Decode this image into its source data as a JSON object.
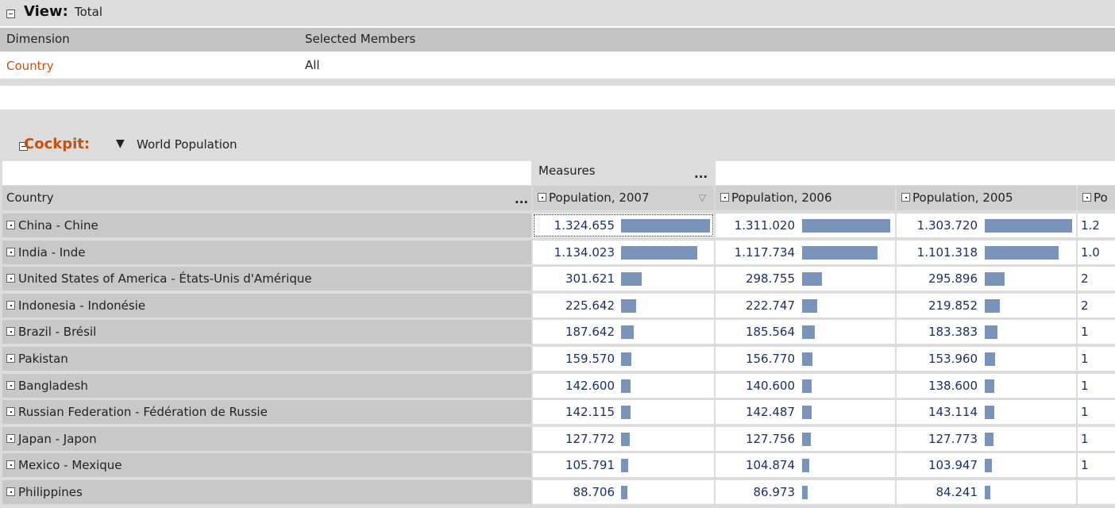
{
  "view": {
    "title": "View:",
    "value": "Total",
    "headers": {
      "dimension": "Dimension",
      "selected": "Selected Members"
    },
    "row": {
      "dimension": "Country",
      "selected": "All"
    }
  },
  "cockpit": {
    "title": "Cockpit:",
    "name": "World Population"
  },
  "grid": {
    "measures_label": "Measures",
    "measures_dots": "...",
    "row_header": "Country",
    "row_header_dots": "...",
    "columns": [
      {
        "label": "Population, 2007",
        "sorted": true
      },
      {
        "label": "Population, 2006",
        "sorted": false
      },
      {
        "label": "Population, 2005",
        "sorted": false
      },
      {
        "label": "Po",
        "sorted": false
      }
    ],
    "sort_icon": "▽",
    "rows": [
      {
        "country": "China - Chine",
        "values": [
          "1.324.655",
          "1.311.020",
          "1.303.720",
          "1.2"
        ],
        "raw": [
          1324.655,
          1311.02,
          1303.72
        ]
      },
      {
        "country": "India - Inde",
        "values": [
          "1.134.023",
          "1.117.734",
          "1.101.318",
          "1.0"
        ],
        "raw": [
          1134.023,
          1117.734,
          1101.318
        ]
      },
      {
        "country": "United States of America - États-Unis d'Amérique",
        "values": [
          "301.621",
          "298.755",
          "295.896",
          "2"
        ],
        "raw": [
          301.621,
          298.755,
          295.896
        ]
      },
      {
        "country": "Indonesia - Indonésie",
        "values": [
          "225.642",
          "222.747",
          "219.852",
          "2"
        ],
        "raw": [
          225.642,
          222.747,
          219.852
        ]
      },
      {
        "country": "Brazil - Brésil",
        "values": [
          "187.642",
          "185.564",
          "183.383",
          "1"
        ],
        "raw": [
          187.642,
          185.564,
          183.383
        ]
      },
      {
        "country": "Pakistan",
        "values": [
          "159.570",
          "156.770",
          "153.960",
          "1"
        ],
        "raw": [
          159.57,
          156.77,
          153.96
        ]
      },
      {
        "country": "Bangladesh",
        "values": [
          "142.600",
          "140.600",
          "138.600",
          "1"
        ],
        "raw": [
          142.6,
          140.6,
          138.6
        ]
      },
      {
        "country": "Russian Federation - Fédération de Russie",
        "values": [
          "142.115",
          "142.487",
          "143.114",
          "1"
        ],
        "raw": [
          142.115,
          142.487,
          143.114
        ]
      },
      {
        "country": "Japan - Japon",
        "values": [
          "127.772",
          "127.756",
          "127.773",
          "1"
        ],
        "raw": [
          127.772,
          127.756,
          127.773
        ]
      },
      {
        "country": "Mexico - Mexique",
        "values": [
          "105.791",
          "104.874",
          "103.947",
          "1"
        ],
        "raw": [
          105.791,
          104.874,
          103.947
        ]
      },
      {
        "country": "Philippines",
        "values": [
          "88.706",
          "86.973",
          "84.241",
          ""
        ],
        "raw": [
          88.706,
          86.973,
          84.241
        ]
      }
    ]
  },
  "colors": {
    "accent": "#c8500a",
    "bar": "#7a93b8",
    "number": "#1a2f6b"
  }
}
